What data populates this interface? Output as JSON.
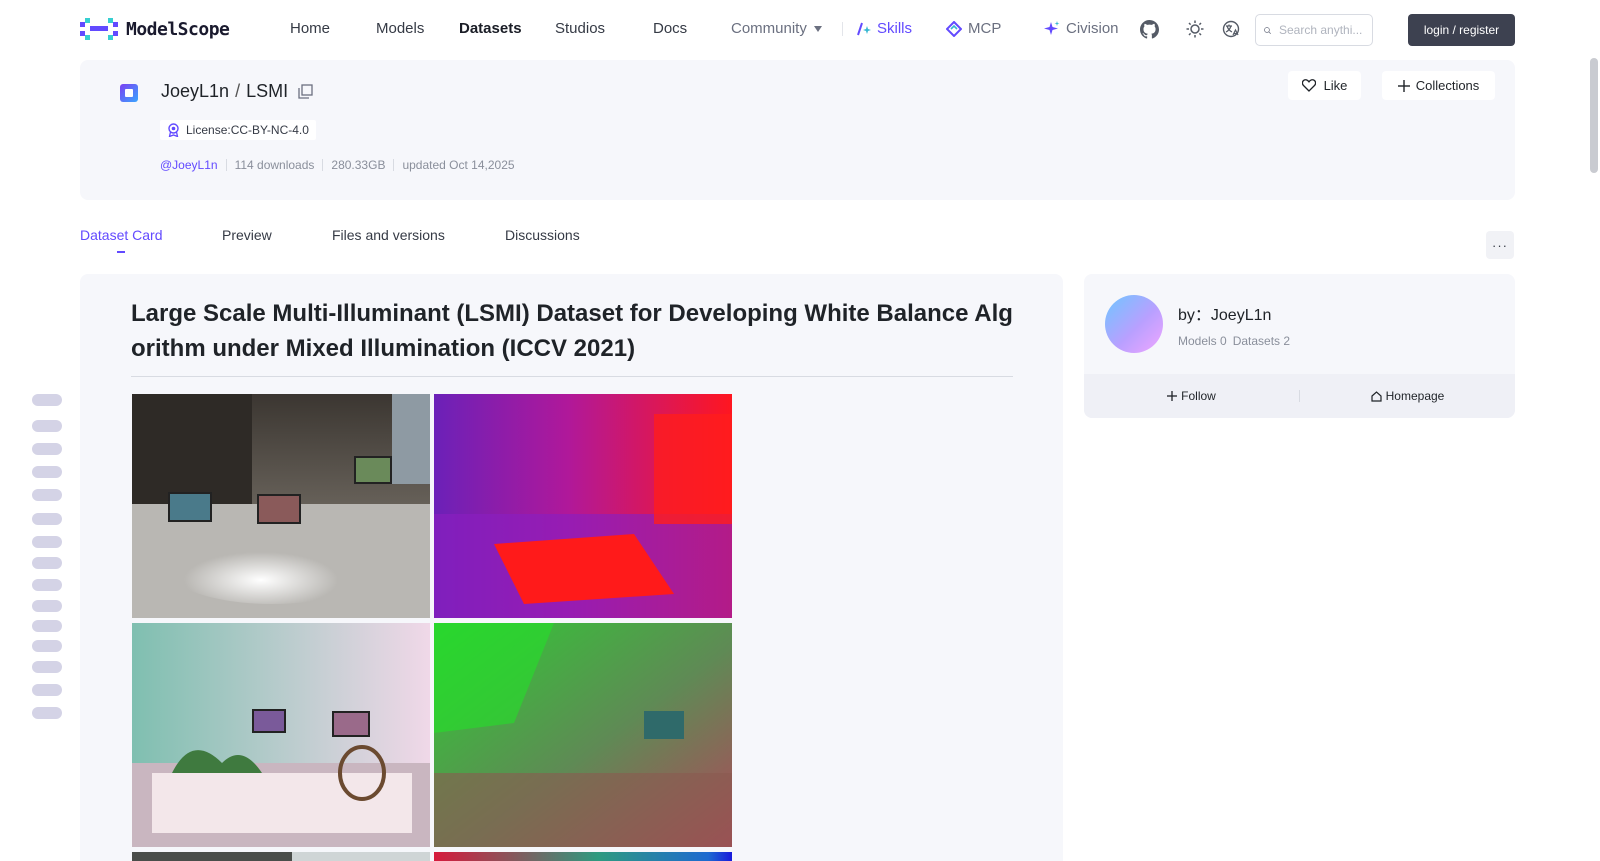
{
  "nav": {
    "logo_text": "ModelScope",
    "items": [
      "Home",
      "Models",
      "Datasets",
      "Studios",
      "Docs"
    ],
    "community": "Community",
    "skills": "Skills",
    "mcp": "MCP",
    "civision": "Civision",
    "search_placeholder": "Search anythi...",
    "login": "login / register"
  },
  "dataset": {
    "owner": "JoeyL1n",
    "name": "LSMI",
    "license": "License:CC-BY-NC-4.0",
    "author_handle": "@JoeyL1n",
    "downloads": "114 downloads",
    "size": "280.33GB",
    "updated": "updated Oct 14,2025",
    "like_label": "Like",
    "collections_label": "Collections"
  },
  "tabs": [
    "Dataset Card",
    "Preview",
    "Files and versions",
    "Discussions"
  ],
  "more_label": "···",
  "card": {
    "title": "Large Scale Multi-Illuminant (LSMI) Dataset for Developing White Balance Algorithm under Mixed Illumination (ICCV 2021)"
  },
  "author_card": {
    "by_line": "by：JoeyL1n",
    "models": "Models 0",
    "datasets": "Datasets 2",
    "follow": "Follow",
    "homepage": "Homepage"
  },
  "colors": {
    "accent": "#624aff",
    "card_bg": "#f6f7fb",
    "login_bg": "#3d4150"
  }
}
